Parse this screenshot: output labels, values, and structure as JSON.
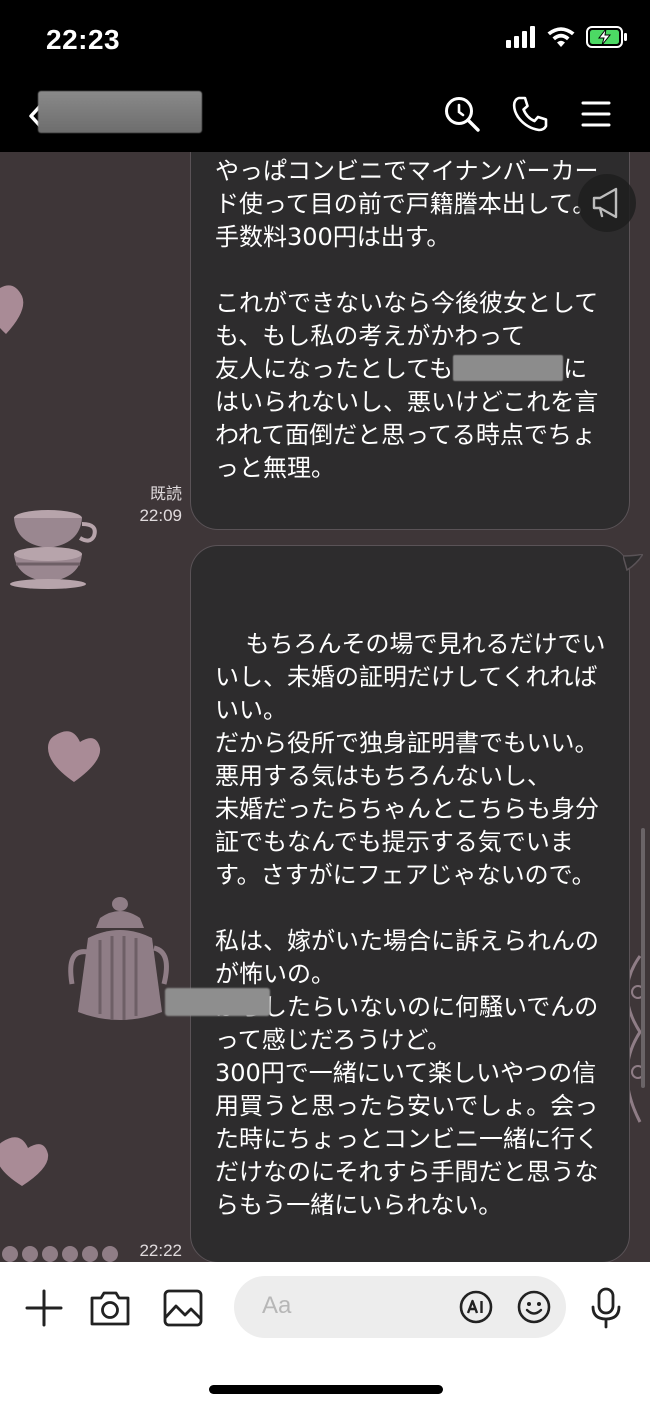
{
  "status_bar": {
    "time": "22:23"
  },
  "header": {
    "contact_name": ""
  },
  "messages": [
    {
      "lines_before_redaction": "やっぱコンビニでマイナンバーカード使って目の前で戸籍謄本出して。\n手数料300円は出す。\n\nこれができないなら今後彼女としても、もし私の考えがかわって\n友人になったとしても",
      "lines_after_redaction": "に\nはいられないし、悪いけどこれを言われて面倒だと思ってる時点でちょっと無理。",
      "read_label": "既読",
      "time": "22:09"
    },
    {
      "text": "もちろんその場で見れるだけでいいし、未婚の証明だけしてくれればいい。\nだから役所で独身証明書でもいい。\n悪用する気はもちろんないし、\n未婚だったらちゃんとこちらも身分証でもなんでも提示する気でいます。さすがにフェアじゃないので。\n\n私は、嫁がいた場合に訴えられんのが怖いの。\nからしたらいないのに何騒いでんのって感じだろうけど。\n300円で一緒にいて楽しいやつの信用買うと思ったら安いでしょ。会った時にちょっとコンビニ一緒に行くだけなのにそれすら手間だと思うならもう一緒にいられない。",
      "time": "22:22"
    }
  ],
  "input": {
    "placeholder": "Aa"
  },
  "icons": {
    "back": "chevron-left-icon",
    "search": "search-icon",
    "call": "phone-icon",
    "menu": "hamburger-menu-icon",
    "add": "plus-icon",
    "camera": "camera-icon",
    "image": "image-icon",
    "ai": "ai-icon",
    "emoji": "emoji-icon",
    "mic": "microphone-icon",
    "announce": "megaphone-icon"
  },
  "colors": {
    "chat_background": "#3e3638",
    "bubble": "#2d2c2d",
    "battery": "#4cd964"
  }
}
